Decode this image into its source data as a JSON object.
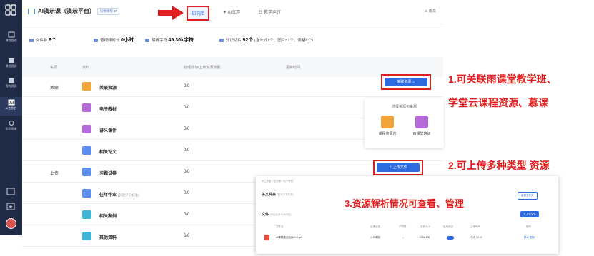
{
  "app": {
    "title": "AI演示课（演示平台）",
    "switch_label": "切换课程 ⇄"
  },
  "sidebar": {
    "items": [
      {
        "label": "课程管理"
      },
      {
        "label": "课程资源"
      },
      {
        "label": "我的资源"
      },
      {
        "label": "AI工作台"
      },
      {
        "label": "知识图谱"
      }
    ]
  },
  "tabs": [
    {
      "label": "知识库"
    },
    {
      "label": "AI应用"
    },
    {
      "label": "教学运行"
    }
  ],
  "top_right": "成员",
  "stats": [
    {
      "label": "文件数",
      "value": "6个"
    },
    {
      "label": "音视频时长",
      "value": "0小时"
    },
    {
      "label": "解析字符",
      "value": "49.30k字符"
    },
    {
      "label": "知识切片",
      "value": "92个",
      "note": "(含公式1个、图片51个、表格6个)"
    }
  ],
  "table": {
    "headers": [
      "来源",
      "资料",
      "处理成功/上传资源数量",
      "更新时间"
    ],
    "rows": [
      {
        "source": "关联",
        "name": "关联资源",
        "count": "0/0",
        "icon_color": "#f2a33a"
      },
      {
        "source": "",
        "name": "电子教材",
        "count": "0/0",
        "icon_color": "#b46ad8"
      },
      {
        "source": "",
        "name": "讲义课件",
        "count": "0/0",
        "icon_color": "#b46ad8"
      },
      {
        "source": "",
        "name": "相关论文",
        "count": "0/0",
        "icon_color": "#5b8def"
      },
      {
        "source": "上传",
        "name": "习题试卷",
        "count": "0/0",
        "icon_color": "#5b8def"
      },
      {
        "source": "",
        "name": "往年作业",
        "note": "(包括评分标准)",
        "count": "0/0",
        "icon_color": "#5b8def"
      },
      {
        "source": "",
        "name": "相关案例",
        "count": "0/0",
        "icon_color": "#3eb5d8"
      },
      {
        "source": "",
        "name": "其他资料",
        "count": "6/6",
        "icon_color": "#3eb5d8"
      }
    ]
  },
  "buttons": {
    "link_resource": "关联资源 ⌄",
    "upload_file": "⇧ 上传文件"
  },
  "popover": {
    "title": "选择资源包来源",
    "options": [
      {
        "label": "课程资源包",
        "color": "#f2a33a"
      },
      {
        "label": "雨课堂班级",
        "color": "#b46ad8"
      }
    ]
  },
  "annotations": {
    "a1_line1": "1.可关联雨课堂教学班、",
    "a1_line2": "学堂云课程资源、慕课",
    "a2": "2.可上传多种类型 资源",
    "a3": "3.资源解析情况可查看、管理"
  },
  "panel": {
    "breadcrumb": "AI工作台 / 知识库 / 电子教材",
    "folder_title": "子文件夹",
    "folder_hint": "(暂无子文件夹)",
    "new_folder": "新建文件夹",
    "file_title": "文件",
    "file_hint": "(开启后参与AI问答)",
    "upload": "⇧ 上传文件",
    "headers": [
      "文件名",
      "处理状态",
      "字符数",
      "文件大小",
      "启用状态",
      "上传时间",
      "操作"
    ],
    "row": {
      "name": "AI课程建设指南v1.0.pdf",
      "status": "◷ 待解析",
      "chars": "--",
      "size": "2.66 MB",
      "time": "今天 10:00",
      "actions": "移动 删除"
    }
  },
  "colors": {
    "accent": "#2f6be0",
    "highlight": "#e02020",
    "sidebar": "#1f2a44"
  }
}
